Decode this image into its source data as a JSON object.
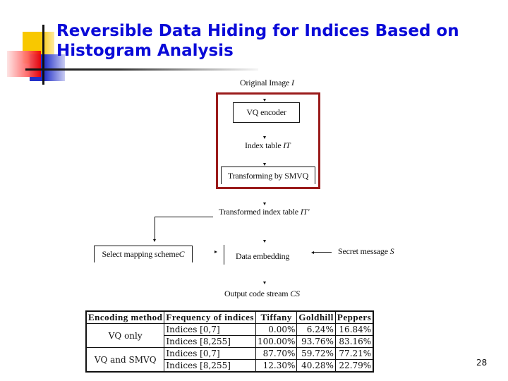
{
  "slide": {
    "title": "Reversible Data Hiding for Indices Based on Histogram Analysis",
    "page_number": "28"
  },
  "diagram": {
    "nodes": {
      "original_image": {
        "label": "Original Image ",
        "var": "I"
      },
      "vq_encoder": {
        "label": "VQ encoder"
      },
      "index_table": {
        "label": "Index table ",
        "var": "IT"
      },
      "transforming": {
        "label": "Transforming by SMVQ"
      },
      "transformed_index_table": {
        "label": "Transformed index table ",
        "var": "IT'"
      },
      "select_mapping": {
        "label": "Select mapping scheme ",
        "var": "C"
      },
      "data_embedding": {
        "label": "Data embedding"
      },
      "secret_message": {
        "label": "Secret message ",
        "var": "S"
      },
      "output_code_stream": {
        "label": "Output code stream ",
        "var": "CS"
      }
    },
    "highlight_color": "#9a1b1b"
  },
  "table": {
    "headers": [
      "Encoding method",
      "Frequency of indices",
      "Tiffany",
      "Goldhill",
      "Peppers"
    ],
    "groups": [
      {
        "method": "VQ only",
        "rows": [
          {
            "range": "Indices [0,7]",
            "values": [
              "0.00%",
              "6.24%",
              "16.84%"
            ]
          },
          {
            "range": "Indices [8,255]",
            "values": [
              "100.00%",
              "93.76%",
              "83.16%"
            ]
          }
        ]
      },
      {
        "method": "VQ and SMVQ",
        "rows": [
          {
            "range": "Indices [0,7]",
            "values": [
              "87.70%",
              "59.72%",
              "77.21%"
            ]
          },
          {
            "range": "Indices [8,255]",
            "values": [
              "12.30%",
              "40.28%",
              "22.79%"
            ]
          }
        ]
      }
    ]
  },
  "colors": {
    "title": "#0a0ad8",
    "logo_yellow": "#f8c800",
    "logo_blue": "#2330c8",
    "logo_red": "#ee0000"
  }
}
